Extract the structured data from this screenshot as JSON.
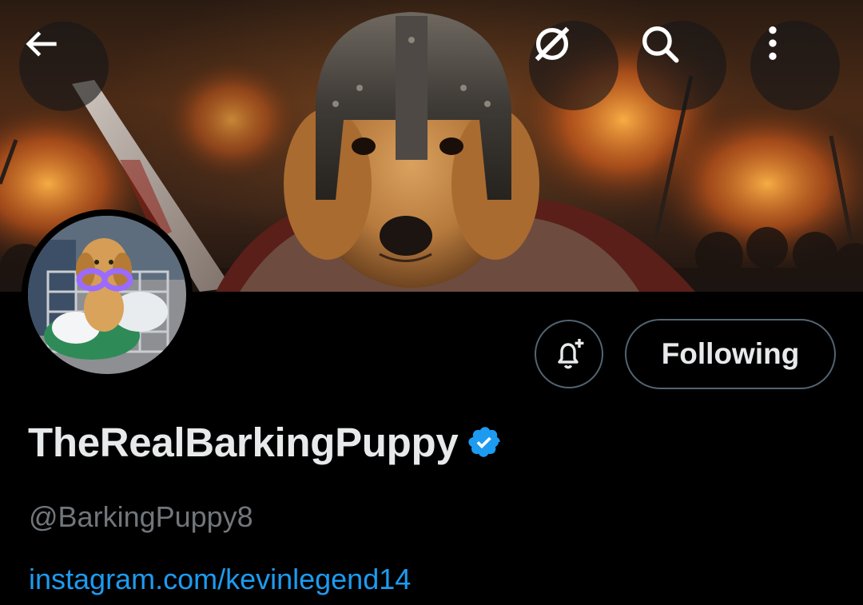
{
  "profile": {
    "display_name": "TheRealBarkingPuppy",
    "handle": "@BarkingPuppy8",
    "link_text": "instagram.com/kevinlegend14",
    "verified": true
  },
  "header": {
    "back_icon": "arrow-left-icon",
    "grok_icon": "grok-icon",
    "search_icon": "search-icon",
    "more_icon": "more-vertical-icon"
  },
  "actions": {
    "notify_icon": "bell-plus-icon",
    "follow_label": "Following"
  },
  "colors": {
    "background": "#000000",
    "primary_text": "#e7e9ea",
    "secondary_text": "#71767b",
    "link": "#1d9bf0",
    "verified_badge": "#1d9bf0",
    "button_border": "#536471"
  }
}
